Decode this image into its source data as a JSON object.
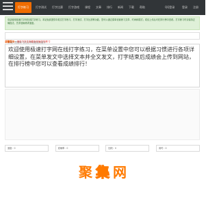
{
  "header": {
    "nav": [
      {
        "label": "打字练习",
        "active": true
      },
      {
        "label": "打字测试",
        "active": false
      },
      {
        "label": "打字比赛",
        "active": false
      },
      {
        "label": "打字游戏",
        "active": false
      },
      {
        "label": "课程",
        "active": false
      },
      {
        "label": "文章",
        "active": false
      },
      {
        "label": "排行",
        "active": false
      },
      {
        "label": "新闻",
        "active": false
      },
      {
        "label": "下载",
        "active": false
      },
      {
        "label": "帮助",
        "active": false
      }
    ],
    "qq_login": "QQ登录",
    "login": "登录",
    "register": "注册"
  },
  "notice": {
    "text": "欢迎使用极速打字网在线打字练习。本站免费提供中英文打字练习、打字测试、打字比赛等功能，您可以通过菜单设置练习文章、时间和模式；成绩上传后可在排行榜中查看。打字练习时请保持正确指法，先求准确再求速度。"
  },
  "search": {
    "placeholder": "请输入您要练习的文章标题或关键字"
  },
  "hint": {
    "prefix": "温馨提示：",
    "text": "请在下方文本框中开始打字练习"
  },
  "typing_area": {
    "text": "欢迎使用极速打字网在线打字练习，在菜单设置中您可以根据习惯进行各项详细设置，在菜单发文中选择文本并全文发文，打字结束后成绩会上传到网站，在排行榜中您可以查看成绩排行！"
  },
  "stats": [
    {
      "label": "速度：0"
    },
    {
      "label": "准确率：0"
    },
    {
      "label": "回改：0"
    },
    {
      "label": "用时：0"
    }
  ],
  "watermark": {
    "chars": [
      "聚",
      "集",
      "网"
    ]
  }
}
